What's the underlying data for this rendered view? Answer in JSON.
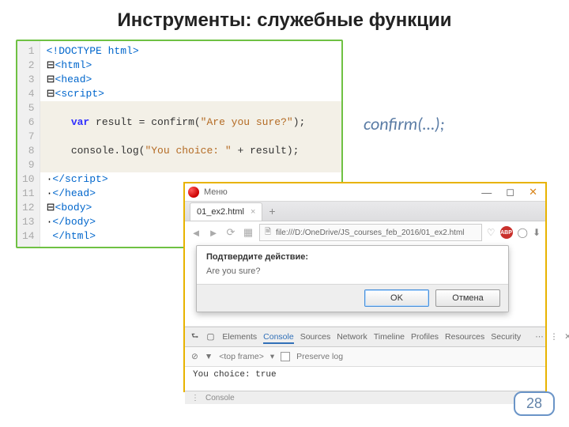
{
  "title": "Инструменты: служебные функции",
  "snippet_label": "confirm(…);",
  "code": {
    "lines": [
      {
        "n": 1,
        "html": "<span class='tag'>&lt;!DOCTYPE html&gt;</span>"
      },
      {
        "n": 2,
        "html": "⊟<span class='tag'>&lt;html&gt;</span>"
      },
      {
        "n": 3,
        "html": "⊟<span class='tag'>&lt;head&gt;</span>"
      },
      {
        "n": 4,
        "html": "⊟<span class='tag'>&lt;script&gt;</span>"
      },
      {
        "n": 5,
        "html": ""
      },
      {
        "n": 6,
        "html": "    <span class='keyword'>var</span> <span class='plain'>result = confirm(</span><span class='string'>\"Are you sure?\"</span><span class='plain'>);</span>"
      },
      {
        "n": 7,
        "html": ""
      },
      {
        "n": 8,
        "html": "    <span class='plain'>console.log(</span><span class='string'>\"You choice: \"</span><span class='plain'> + result);</span>"
      },
      {
        "n": 9,
        "html": ""
      },
      {
        "n": 10,
        "html": "·<span class='tag'>&lt;/script&gt;</span>"
      },
      {
        "n": 11,
        "html": "·<span class='tag'>&lt;/head&gt;</span>"
      },
      {
        "n": 12,
        "html": "⊟<span class='tag'>&lt;body&gt;</span>"
      },
      {
        "n": 13,
        "html": "·<span class='tag'>&lt;/body&gt;</span>"
      },
      {
        "n": 14,
        "html": " <span class='tag'>&lt;/html&gt;</span>"
      }
    ],
    "highlight_from": 5,
    "highlight_to": 9
  },
  "browser": {
    "menu": "Меню",
    "tab_label": "01_ex2.html",
    "address": "file:///D:/OneDrive/JS_courses_feb_2016/01_ex2.html",
    "abp": "ABP",
    "dialog": {
      "title": "Подтвердите действие:",
      "text": "Are you sure?",
      "ok": "OK",
      "cancel": "Отмена"
    },
    "devtools": {
      "tabs": [
        "Elements",
        "Console",
        "Sources",
        "Network",
        "Timeline",
        "Profiles",
        "Resources",
        "Security"
      ],
      "active": 1,
      "frame_label": "<top frame>",
      "preserve_log": "Preserve log",
      "console_output": "You choice: true",
      "footer_label": "Console"
    }
  },
  "page_number": "28"
}
